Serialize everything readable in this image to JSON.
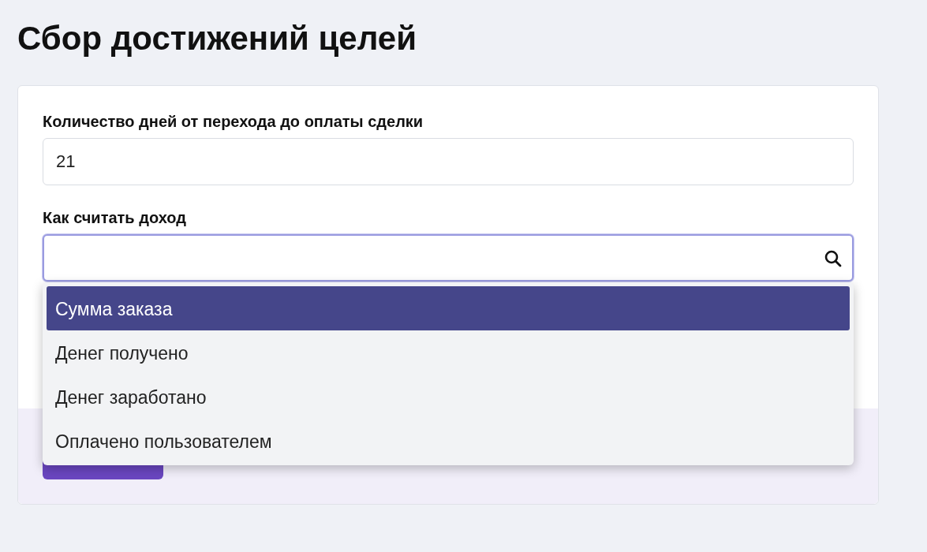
{
  "title": "Сбор достижений целей",
  "fields": [
    {
      "kind": "text",
      "label": "Количество дней от перехода до оплаты сделки",
      "value": "21"
    },
    {
      "kind": "select",
      "label": "Как считать доход",
      "focused": true,
      "expanded": true,
      "options": [
        {
          "label": "Сумма заказа",
          "selected": true
        },
        {
          "label": "Денег получено",
          "selected": false
        },
        {
          "label": "Денег заработано",
          "selected": false
        },
        {
          "label": "Оплачено пользователем",
          "selected": false
        }
      ]
    }
  ]
}
